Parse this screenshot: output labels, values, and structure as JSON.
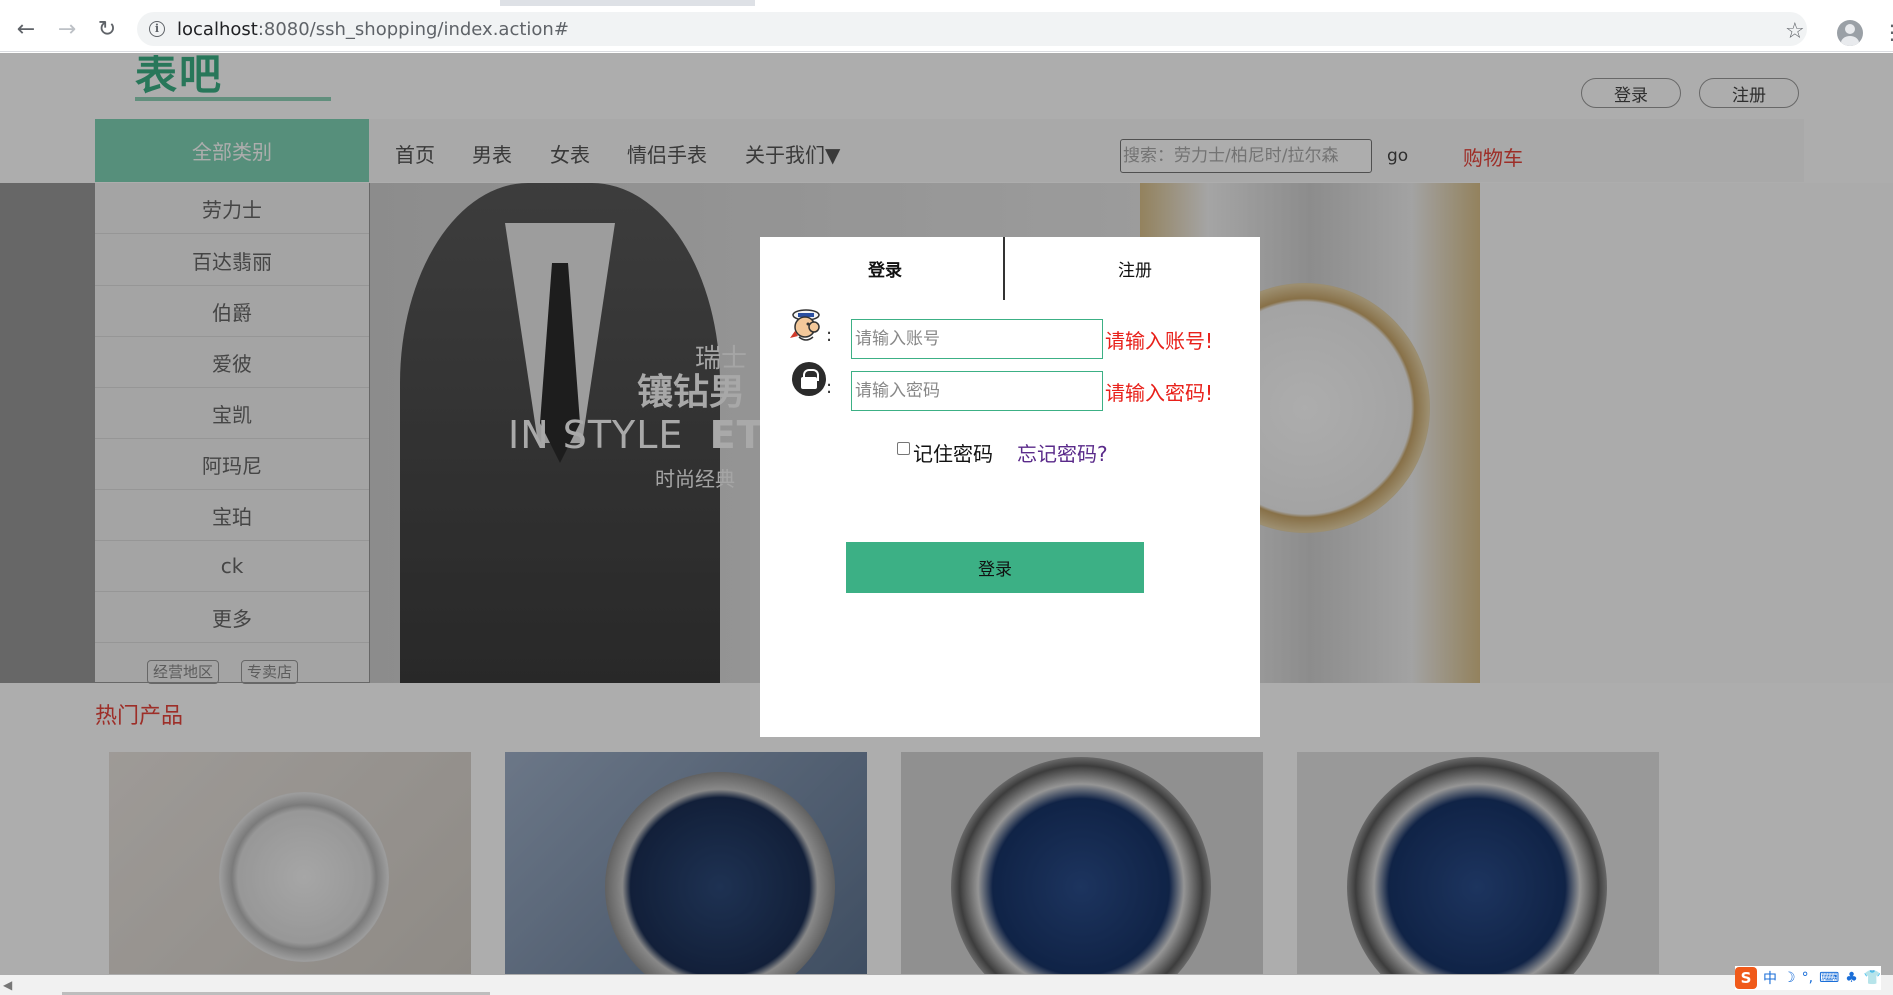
{
  "browser": {
    "url_host": "localhost",
    "url_path": ":8080/ssh_shopping/index.action#"
  },
  "site": {
    "logo_text": "表吧",
    "login_label": "登录",
    "register_label": "注册",
    "all_categories": "全部类别",
    "nav": [
      "首页",
      "男表",
      "女表",
      "情侣手表",
      "关于我们▼"
    ],
    "search_placeholder": "搜索：劳力士/柏尼时/拉尔森",
    "go_label": "go",
    "cart_label": "购物车",
    "categories": [
      "劳力士",
      "百达翡丽",
      "伯爵",
      "爱彼",
      "宝凯",
      "阿玛尼",
      "宝珀",
      "ck",
      "更多"
    ],
    "tags": [
      "经营地区",
      "专卖店"
    ],
    "hot_title": "热门产品"
  },
  "banner": {
    "line1": "瑞士",
    "line2": "镶钻男",
    "line3_a": "IN STYLE",
    "line3_b": "ET",
    "line4": "时尚经典"
  },
  "modal": {
    "tab_login": "登录",
    "tab_register": "注册",
    "account_placeholder": "请输入账号",
    "password_placeholder": "请输入密码",
    "account_error": "请输入账号!",
    "password_error": "请输入密码!",
    "colon": ":",
    "remember_label": "记住密码",
    "forgot_label": "忘记密码?",
    "submit_label": "登录"
  },
  "ime": {
    "logo": "S",
    "items": [
      "中",
      "☽",
      "°,",
      "⌨",
      "♣",
      "👕"
    ]
  },
  "colors": {
    "brand_green": "#3cb085",
    "error_red": "#e8201a",
    "accent_red": "#e8453c"
  }
}
